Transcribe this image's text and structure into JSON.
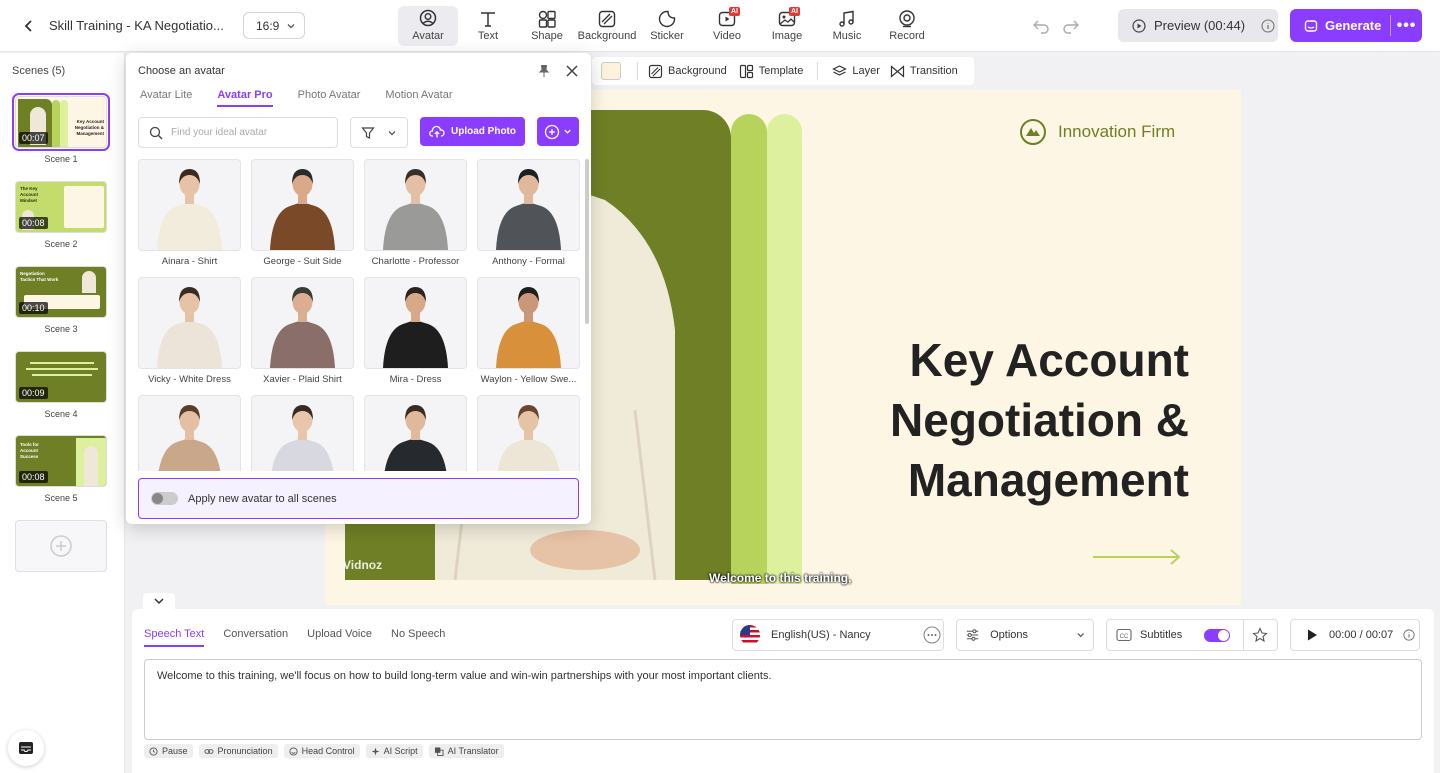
{
  "header": {
    "project_title": "Skill Training - KA Negotiatio...",
    "aspect_ratio": "16:9",
    "tools": [
      {
        "label": "Avatar",
        "icon": "avatar-icon",
        "active": true
      },
      {
        "label": "Text",
        "icon": "text-icon"
      },
      {
        "label": "Shape",
        "icon": "shape-icon"
      },
      {
        "label": "Background",
        "icon": "background-icon"
      },
      {
        "label": "Sticker",
        "icon": "sticker-icon"
      },
      {
        "label": "Video",
        "icon": "video-icon",
        "badge": "AI"
      },
      {
        "label": "Image",
        "icon": "image-icon",
        "badge": "AI"
      },
      {
        "label": "Music",
        "icon": "music-icon"
      },
      {
        "label": "Record",
        "icon": "record-icon"
      }
    ],
    "preview_label": "Preview (00:44)",
    "generate_label": "Generate",
    "more_label": "•••"
  },
  "scenes": {
    "title": "Scenes (5)",
    "items": [
      {
        "label": "Scene 1",
        "duration": "00:07",
        "selected": true
      },
      {
        "label": "Scene 2",
        "duration": "00:08"
      },
      {
        "label": "Scene 3",
        "duration": "00:10"
      },
      {
        "label": "Scene 4",
        "duration": "00:09"
      },
      {
        "label": "Scene 5",
        "duration": "00:08"
      }
    ]
  },
  "subbar": {
    "background_label": "Background",
    "template_label": "Template",
    "layer_label": "Layer",
    "transition_label": "Transition",
    "swatch_color": "#fdf2dc"
  },
  "canvas": {
    "logo_text": "Innovation Firm",
    "headline_lines": [
      "Key Account",
      "Negotiation &",
      "Management"
    ],
    "caption": "Welcome to this training,",
    "watermark": "Vidnoz",
    "colors": {
      "panel": "#6f7f25",
      "bar1": "#b8d35c",
      "bar2": "#dcf09e",
      "bg": "#fef6e4"
    }
  },
  "avatar_popup": {
    "title": "Choose an avatar",
    "tabs": [
      {
        "label": "Avatar Lite"
      },
      {
        "label": "Avatar Pro",
        "active": true
      },
      {
        "label": "Photo Avatar"
      },
      {
        "label": "Motion Avatar"
      }
    ],
    "search_placeholder": "Find your ideal avatar",
    "upload_label": "Upload Photo",
    "avatars": [
      {
        "name": "Ainara - Shirt",
        "outfit": "#f2ecdc",
        "hair": "#3b2a20",
        "skin": "#e6c2a6"
      },
      {
        "name": "George - Suit Side",
        "outfit": "#7a4a28",
        "hair": "#2a2a2a",
        "skin": "#d9a98a"
      },
      {
        "name": "Charlotte - Professor",
        "outfit": "#9a9a98",
        "hair": "#3a2e28",
        "skin": "#e4bfa4"
      },
      {
        "name": "Anthony - Formal",
        "outfit": "#505458",
        "hair": "#1f1f1f",
        "skin": "#e0b89c"
      },
      {
        "name": "Vicky - White Dress",
        "outfit": "#ece4d8",
        "hair": "#3a2c24",
        "skin": "#e6c2a6"
      },
      {
        "name": "Xavier - Plaid Shirt",
        "outfit": "#8a6e6a",
        "hair": "#3a3a38",
        "skin": "#d9ae92"
      },
      {
        "name": "Mira - Dress",
        "outfit": "#1e1e1e",
        "hair": "#2a2320",
        "skin": "#d8a988"
      },
      {
        "name": "Waylon - Yellow Swe...",
        "outfit": "#d8913a",
        "hair": "#1e1e1e",
        "skin": "#c9977a"
      },
      {
        "name": "",
        "outfit": "#c9a78a",
        "hair": "#5a3e2c",
        "skin": "#e4bfa4"
      },
      {
        "name": "",
        "outfit": "#d8d8e0",
        "hair": "#3a2a22",
        "skin": "#e8c6ac"
      },
      {
        "name": "",
        "outfit": "#26292e",
        "hair": "#3a2c22",
        "skin": "#e0b89c"
      },
      {
        "name": "",
        "outfit": "#ede6d6",
        "hair": "#6a4630",
        "skin": "#e6c2a6"
      }
    ],
    "apply_label": "Apply new avatar to all scenes"
  },
  "speech": {
    "tabs": [
      {
        "label": "Speech Text",
        "active": true
      },
      {
        "label": "Conversation"
      },
      {
        "label": "Upload Voice"
      },
      {
        "label": "No Speech"
      }
    ],
    "voice": "English(US) - Nancy",
    "options_label": "Options",
    "subtitles_label": "Subtitles",
    "subtitles_on": true,
    "time": "00:00 / 00:07",
    "script": "Welcome to this training, we'll focus on how to build long-term value and win-win partnerships with your most important clients.",
    "chips": [
      "Pause",
      "Pronunciation",
      "Head Control",
      "AI Script",
      "AI Translator"
    ]
  },
  "accent_color": "#8b3dff"
}
